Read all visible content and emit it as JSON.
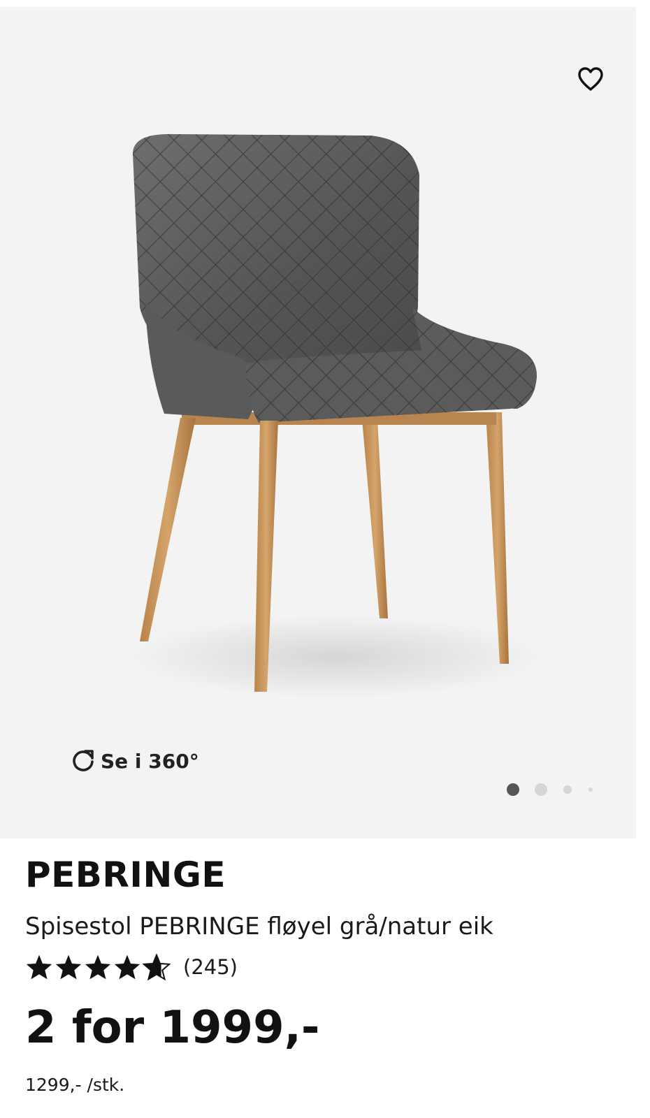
{
  "gallery": {
    "view360_label": "Se i 360°",
    "image_count": 4,
    "active_image": 1,
    "colors": {
      "background": "#f3f3f3",
      "dot_active": "#555555",
      "dot_inactive": "#d6d6d6"
    }
  },
  "product": {
    "brand": "PEBRINGE",
    "subtitle": "Spisestol PEBRINGE fløyel grå/natur eik",
    "rating": 4.6,
    "rating_max": 5,
    "review_count": "(245)",
    "price": "2 for 1999,-",
    "unit_price": "1299,- /stk."
  },
  "icons": {
    "favorite": "heart-outline-icon",
    "rotate": "rotate-360-icon",
    "star": "star-icon"
  }
}
